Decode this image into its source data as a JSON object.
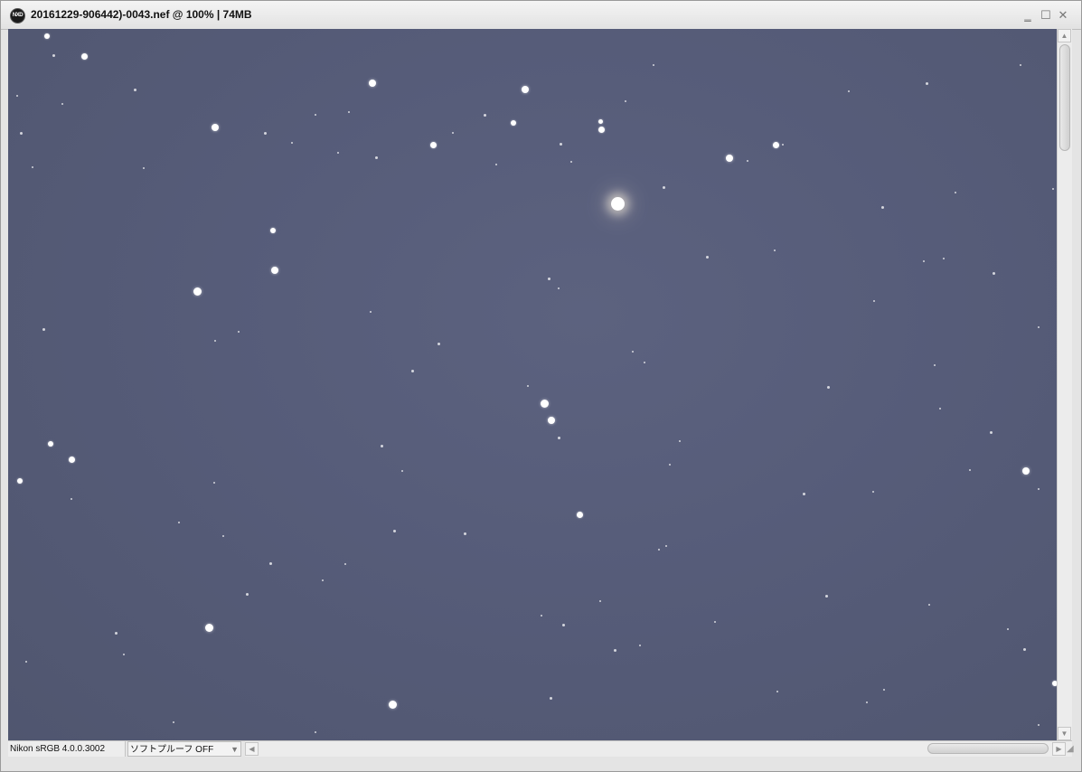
{
  "window": {
    "app_icon_text": "NXD",
    "title": "20161229-906442)-0043.nef @ 100% | 74MB",
    "minimize_glyph": "‗",
    "maximize_glyph": "☐",
    "close_glyph": "✕"
  },
  "status": {
    "color_profile": "Nikon sRGB 4.0.0.3002",
    "soft_proof": "ソフトプルーフ OFF"
  },
  "icons": {
    "app": "nx-studio-logo-icon",
    "scroll_up": "arrow-up-icon",
    "scroll_down": "arrow-down-icon",
    "scroll_left": "arrow-left-icon",
    "scroll_right": "arrow-right-icon",
    "dropdown": "chevron-down-icon",
    "grip": "resize-grip-icon"
  },
  "colors": {
    "sky": "#565c79",
    "star": "#ffffff"
  }
}
